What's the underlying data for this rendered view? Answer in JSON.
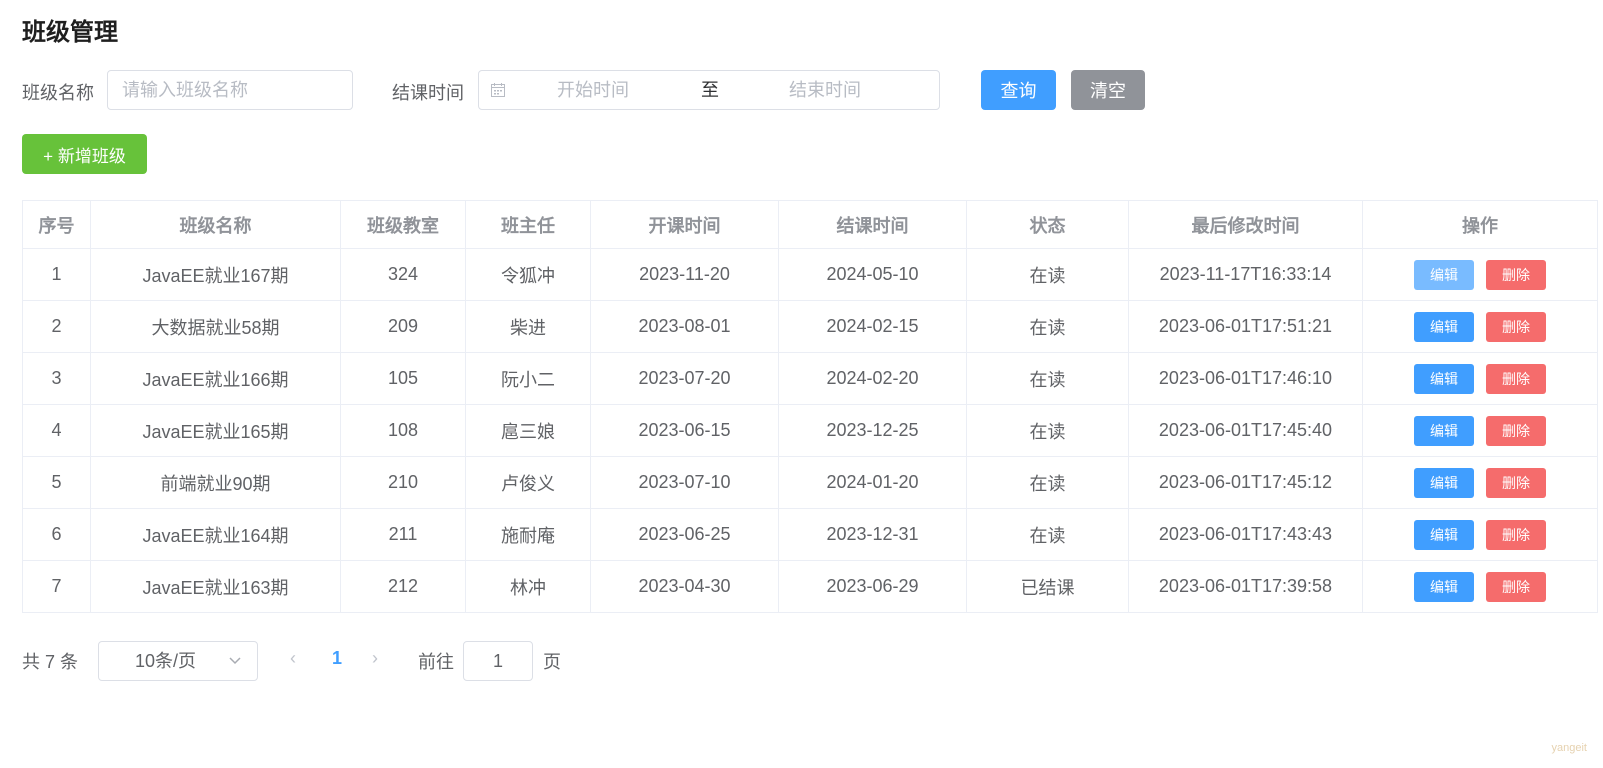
{
  "page": {
    "title": "班级管理"
  },
  "search": {
    "name_label": "班级名称",
    "name_placeholder": "请输入班级名称",
    "name_value": "",
    "time_label": "结课时间",
    "start_placeholder": "开始时间",
    "separator": "至",
    "end_placeholder": "结束时间",
    "query_label": "查询",
    "clear_label": "清空"
  },
  "toolbar": {
    "add_label": "+ 新增班级"
  },
  "table": {
    "headers": [
      "序号",
      "班级名称",
      "班级教室",
      "班主任",
      "开课时间",
      "结课时间",
      "状态",
      "最后修改时间",
      "操作"
    ],
    "edit_label": "编辑",
    "delete_label": "删除",
    "rows": [
      {
        "index": "1",
        "name": "JavaEE就业167期",
        "room": "324",
        "teacher": "令狐冲",
        "begin": "2023-11-20",
        "end": "2024-05-10",
        "status": "在读",
        "updated": "2023-11-17T16:33:14"
      },
      {
        "index": "2",
        "name": "大数据就业58期",
        "room": "209",
        "teacher": "柴进",
        "begin": "2023-08-01",
        "end": "2024-02-15",
        "status": "在读",
        "updated": "2023-06-01T17:51:21"
      },
      {
        "index": "3",
        "name": "JavaEE就业166期",
        "room": "105",
        "teacher": "阮小二",
        "begin": "2023-07-20",
        "end": "2024-02-20",
        "status": "在读",
        "updated": "2023-06-01T17:46:10"
      },
      {
        "index": "4",
        "name": "JavaEE就业165期",
        "room": "108",
        "teacher": "扈三娘",
        "begin": "2023-06-15",
        "end": "2023-12-25",
        "status": "在读",
        "updated": "2023-06-01T17:45:40"
      },
      {
        "index": "5",
        "name": "前端就业90期",
        "room": "210",
        "teacher": "卢俊义",
        "begin": "2023-07-10",
        "end": "2024-01-20",
        "status": "在读",
        "updated": "2023-06-01T17:45:12"
      },
      {
        "index": "6",
        "name": "JavaEE就业164期",
        "room": "211",
        "teacher": "施耐庵",
        "begin": "2023-06-25",
        "end": "2023-12-31",
        "status": "在读",
        "updated": "2023-06-01T17:43:43"
      },
      {
        "index": "7",
        "name": "JavaEE就业163期",
        "room": "212",
        "teacher": "林冲",
        "begin": "2023-04-30",
        "end": "2023-06-29",
        "status": "已结课",
        "updated": "2023-06-01T17:39:58"
      }
    ]
  },
  "pagination": {
    "total_text": "共 7 条",
    "page_size": "10条/页",
    "prev": "‹",
    "current_page": "1",
    "next": "›",
    "goto_label": "前往",
    "goto_value": "1",
    "goto_unit": "页"
  },
  "watermark": "yangeit",
  "colors": {
    "primary": "#409eff",
    "success": "#67c23a",
    "danger": "#f56c6c",
    "info": "#909399"
  },
  "icons": {
    "date_picker": "calendar-icon",
    "page_size_select": "chevron-down-icon"
  }
}
